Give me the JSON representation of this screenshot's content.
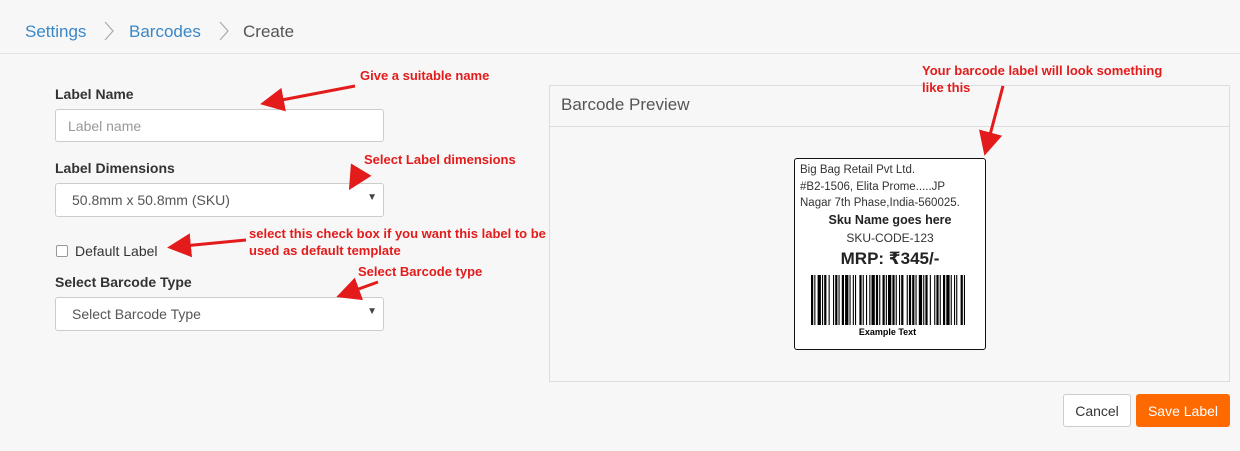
{
  "breadcrumb": {
    "items": [
      {
        "label": "Settings"
      },
      {
        "label": "Barcodes"
      },
      {
        "label": "Create"
      }
    ]
  },
  "form": {
    "label_name": {
      "label": "Label Name",
      "placeholder": "Label name",
      "value": ""
    },
    "label_dimensions": {
      "label": "Label Dimensions",
      "selected": "50.8mm x 50.8mm (SKU)"
    },
    "default_label": {
      "label": "Default Label",
      "checked": false
    },
    "barcode_type": {
      "label": "Select Barcode Type",
      "selected": "Select Barcode Type"
    }
  },
  "annotations": {
    "name_hint": "Give a suitable name",
    "dimensions_hint": "Select Label dimensions",
    "checkbox_hint_line1": "select this check box if you want this label to be",
    "checkbox_hint_line2": "used as default template",
    "barcode_type_hint": "Select Barcode type",
    "preview_hint_line1": "Your barcode label will look something",
    "preview_hint_line2": "like this",
    "color": "#e31b1b"
  },
  "preview": {
    "title": "Barcode Preview",
    "label": {
      "company_line1": "Big Bag Retail Pvt Ltd.",
      "company_line2": "#B2-1506, Elita Prome.....JP",
      "company_line3": "Nagar 7th Phase,India-560025.",
      "sku_name": "Sku Name goes here",
      "sku_code": "SKU-CODE-123",
      "mrp": "MRP: ₹345/-",
      "barcode_text": "Example Text"
    }
  },
  "actions": {
    "cancel": "Cancel",
    "save": "Save Label",
    "save_color": "#ff6a00"
  },
  "icons": {
    "breadcrumb_separator": "chevron-right-icon",
    "select_caret": "caret-down-icon"
  }
}
